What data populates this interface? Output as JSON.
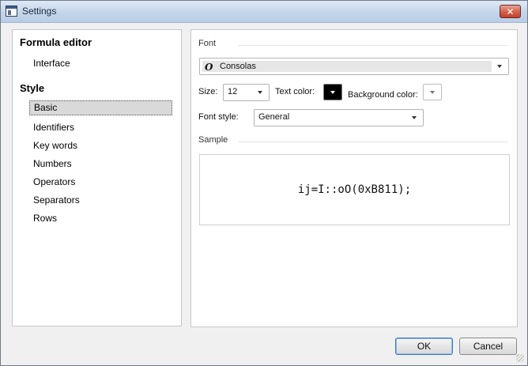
{
  "window": {
    "title": "Settings"
  },
  "sidebar": {
    "sections": [
      {
        "label": "Formula editor",
        "items": [
          "Interface"
        ]
      },
      {
        "label": "Style",
        "items": [
          "Basic",
          "Identifiers",
          "Key words",
          "Numbers",
          "Operators",
          "Separators",
          "Rows"
        ]
      }
    ],
    "selected": "Basic"
  },
  "font": {
    "section_label": "Font",
    "family": "Consolas",
    "size_label": "Size:",
    "size": "12",
    "text_color_label": "Text color:",
    "text_color": "#000000",
    "background_color_label": "Background color:",
    "style_label": "Font style:",
    "style": "General"
  },
  "sample": {
    "section_label": "Sample",
    "text": "ij=I::oO(0xB811);"
  },
  "buttons": {
    "ok": "OK",
    "cancel": "Cancel"
  }
}
